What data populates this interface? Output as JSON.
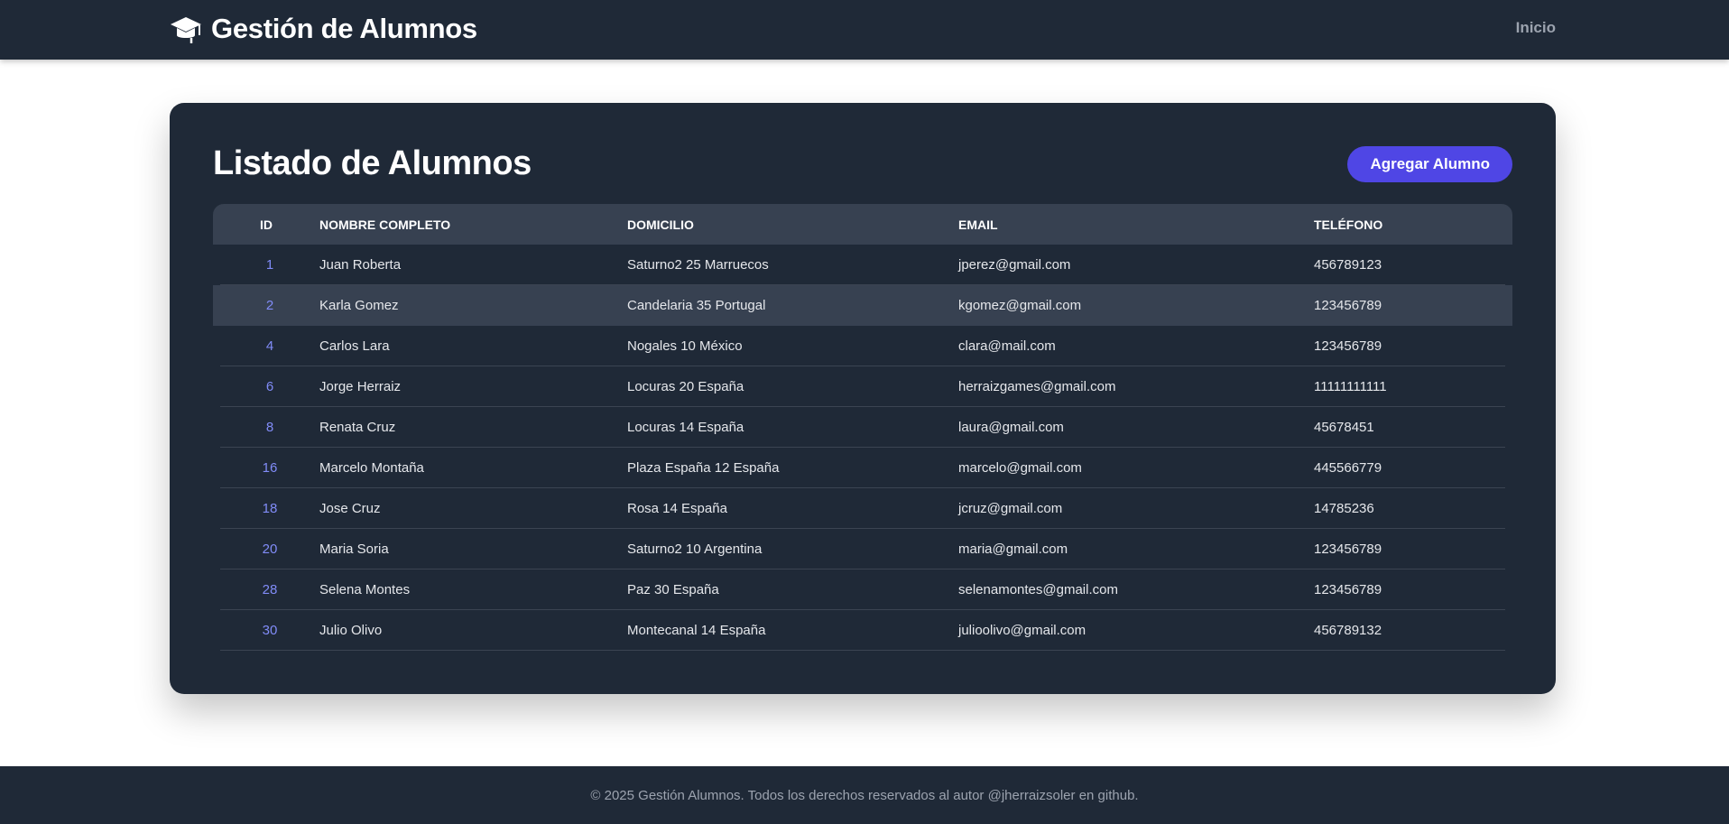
{
  "header": {
    "brand_title": "Gestión de Alumnos",
    "brand_icon": "graduation-cap-icon",
    "nav_link": "Inicio"
  },
  "main": {
    "title": "Listado de Alumnos",
    "add_button_label": "Agregar Alumno",
    "table": {
      "headers": {
        "id": "ID",
        "name": "NOMBRE COMPLETO",
        "address": "DOMICILIO",
        "email": "EMAIL",
        "phone": "TELÉFONO"
      },
      "rows": [
        {
          "id": "1",
          "name": "Juan Roberta",
          "address": "Saturno2 25 Marruecos",
          "email": "jperez@gmail.com",
          "phone": "456789123"
        },
        {
          "id": "2",
          "name": "Karla Gomez",
          "address": "Candelaria 35 Portugal",
          "email": "kgomez@gmail.com",
          "phone": "123456789"
        },
        {
          "id": "4",
          "name": "Carlos Lara",
          "address": "Nogales 10 México",
          "email": "clara@mail.com",
          "phone": "123456789"
        },
        {
          "id": "6",
          "name": "Jorge Herraiz",
          "address": "Locuras 20 España",
          "email": "herraizgames@gmail.com",
          "phone": "11111111111"
        },
        {
          "id": "8",
          "name": "Renata Cruz",
          "address": "Locuras 14 España",
          "email": "laura@gmail.com",
          "phone": "45678451"
        },
        {
          "id": "16",
          "name": "Marcelo Montaña",
          "address": "Plaza España 12 España",
          "email": "marcelo@gmail.com",
          "phone": "445566779"
        },
        {
          "id": "18",
          "name": "Jose Cruz",
          "address": "Rosa 14 España",
          "email": "jcruz@gmail.com",
          "phone": "14785236"
        },
        {
          "id": "20",
          "name": "Maria Soria",
          "address": "Saturno2 10 Argentina",
          "email": "maria@gmail.com",
          "phone": "123456789"
        },
        {
          "id": "28",
          "name": "Selena Montes",
          "address": "Paz 30 España",
          "email": "selenamontes@gmail.com",
          "phone": "123456789"
        },
        {
          "id": "30",
          "name": "Julio Olivo",
          "address": "Montecanal 14 España",
          "email": "julioolivo@gmail.com",
          "phone": "456789132"
        }
      ],
      "highlighted_row_index": 1
    }
  },
  "footer": {
    "text": "© 2025 Gestión Alumnos. Todos los derechos reservados al autor @jherraizsoler en github."
  },
  "colors": {
    "navbar_bg": "#1f2937",
    "card_bg": "#1f2937",
    "header_row_bg": "#374151",
    "accent": "#4f46e5",
    "id_text": "#818cf8",
    "muted_text": "#9ca3af"
  }
}
